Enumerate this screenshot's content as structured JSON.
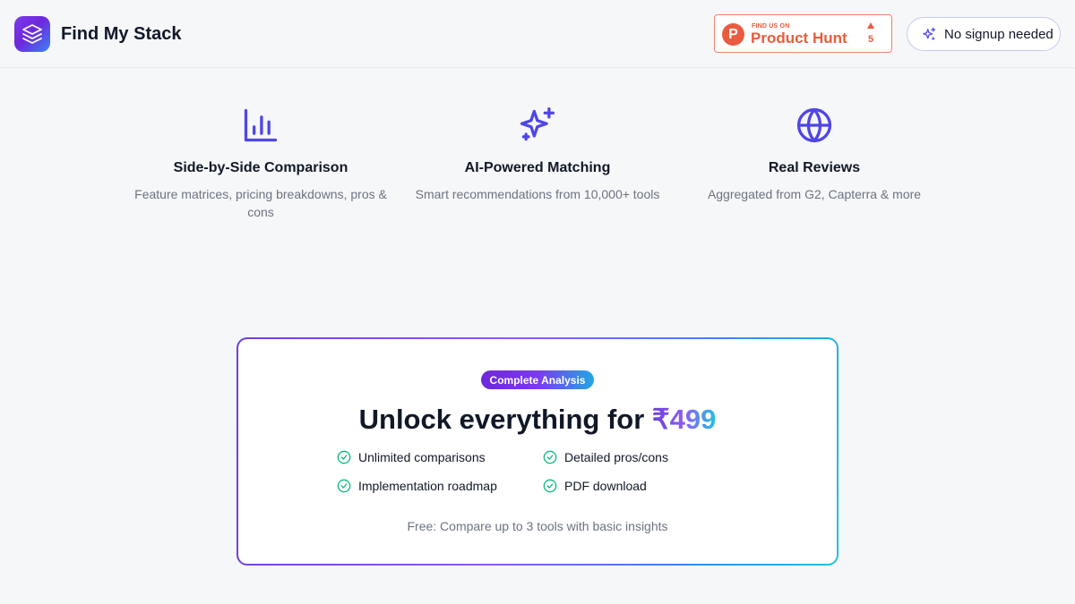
{
  "header": {
    "brand": "Find My Stack",
    "product_hunt": {
      "small_text": "FIND US ON",
      "big_text": "Product Hunt",
      "logo_letter": "P",
      "upvotes": "5"
    },
    "signup_label": "No signup needed"
  },
  "features": [
    {
      "icon": "bar-chart-icon",
      "title": "Side-by-Side Comparison",
      "description": "Feature matrices, pricing breakdowns, pros & cons"
    },
    {
      "icon": "sparkles-icon",
      "title": "AI-Powered Matching",
      "description": "Smart recommendations from 10,000+ tools"
    },
    {
      "icon": "globe-icon",
      "title": "Real Reviews",
      "description": "Aggregated from G2, Capterra & more"
    }
  ],
  "pricing": {
    "badge": "Complete Analysis",
    "headline_prefix": "Unlock everything for ",
    "price": "₹499",
    "benefits": [
      "Unlimited comparisons",
      "Detailed pros/cons",
      "Implementation roadmap",
      "PDF download"
    ],
    "free_note": "Free: Compare up to 3 tools with basic insights"
  },
  "colors": {
    "accent": "#4f46e5",
    "product_hunt": "#ea5b3f",
    "check": "#10b981",
    "muted_text": "#6b7280"
  }
}
